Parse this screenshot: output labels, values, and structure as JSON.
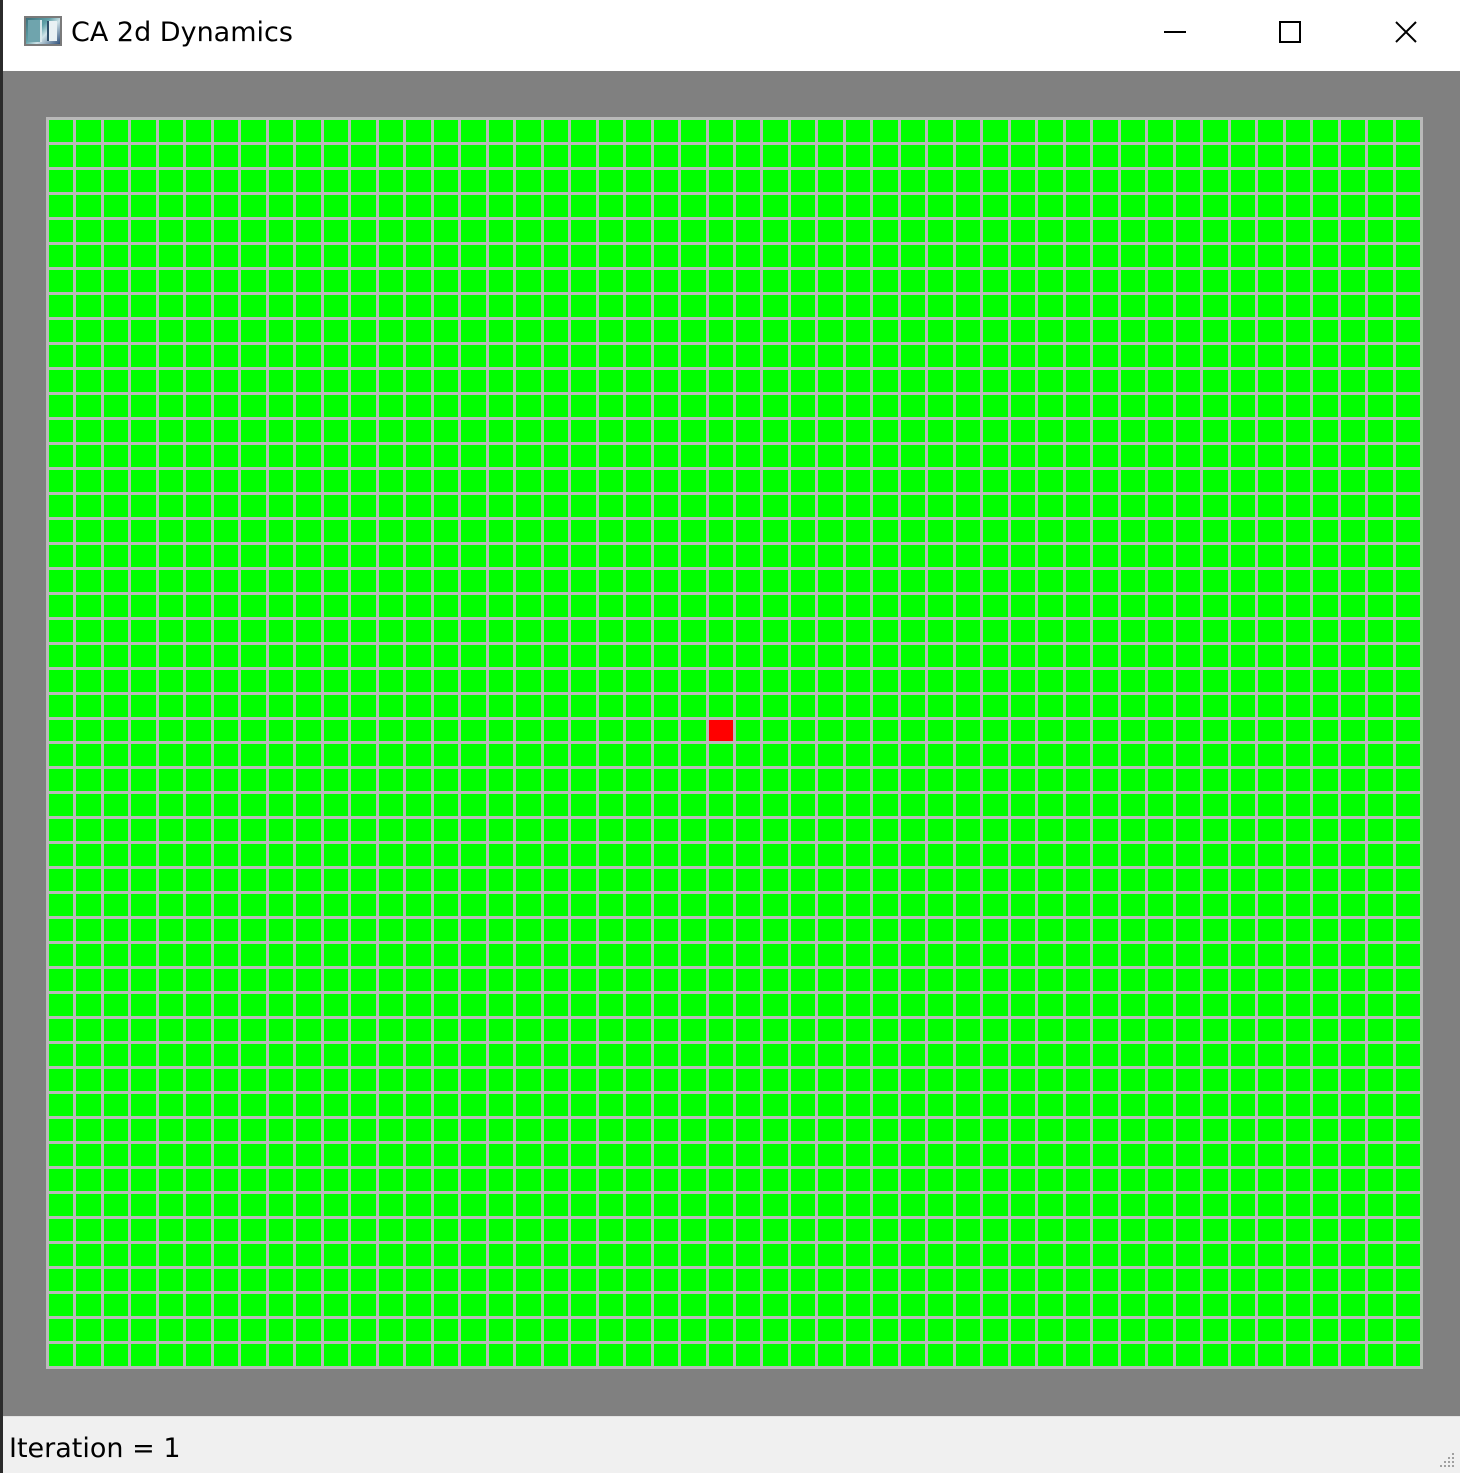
{
  "window": {
    "title": "CA 2d Dynamics",
    "icon": "application-window-icon",
    "controls": {
      "minimize": "minimize-icon",
      "maximize": "maximize-icon",
      "close": "close-icon"
    }
  },
  "grid": {
    "rows": 50,
    "columns": 50,
    "cell_color_default": "#00ff00",
    "cell_color_active": "#ff0000",
    "gridline_color": "#b9b9b9",
    "background_color": "#808080",
    "active_cells": [
      {
        "row": 24,
        "col": 24
      }
    ]
  },
  "status": {
    "text": "Iteration = 1"
  }
}
